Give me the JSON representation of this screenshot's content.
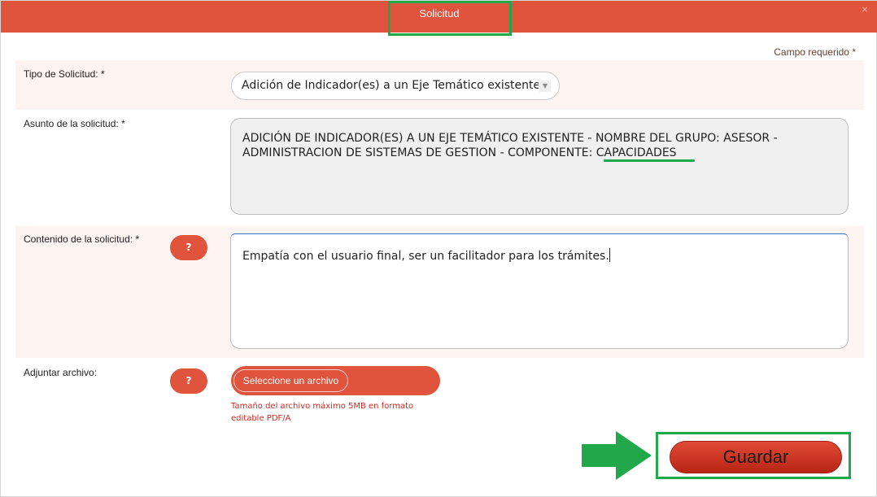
{
  "dialog": {
    "title": "Solicitud",
    "close_icon": "×",
    "required_note": "Campo requerido *"
  },
  "form": {
    "request_type": {
      "label": "Tipo de Solicitud: *",
      "selected_value": "Adición de Indicador(es) a un Eje Temático existente"
    },
    "subject": {
      "label": "Asunto de la solicitud: *",
      "value": "ADICIÓN DE INDICADOR(ES) A UN EJE TEMÁTICO EXISTENTE - NOMBRE DEL GRUPO: ASESOR - ADMINISTRACION DE SISTEMAS DE GESTION - COMPONENTE: CAPACIDADES"
    },
    "content": {
      "label": "Contenido de la solicitud: *",
      "help_label": "?",
      "value": "Empatía con el usuario final, ser un facilitador para los trámites."
    },
    "attachment": {
      "label": "Adjuntar archivo:",
      "help_label": "?",
      "button_label": "Seleccione un archivo",
      "note": "Tamaño del archivo máximo 5MB en formato editable PDF/A"
    }
  },
  "actions": {
    "save_label": "Guardar"
  },
  "colors": {
    "header": "#e0533d",
    "highlight": "#20a84a",
    "row_background": "#fdf4f1",
    "note_text": "#d9261c"
  }
}
